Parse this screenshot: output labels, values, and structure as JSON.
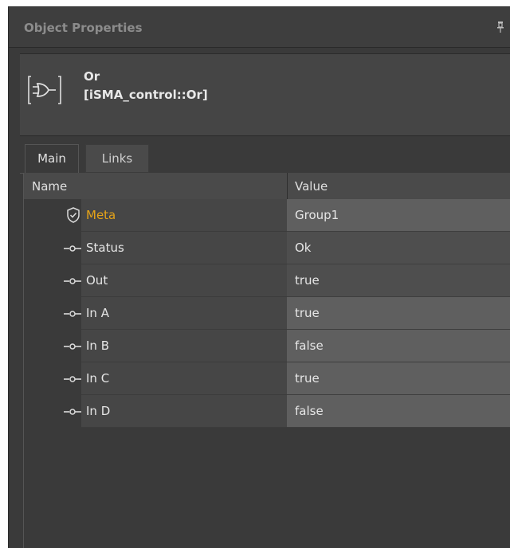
{
  "panel": {
    "title": "Object Properties"
  },
  "object": {
    "name": "Or",
    "type": "[iSMA_control::Or]"
  },
  "tabs": {
    "main": "Main",
    "links": "Links",
    "active": "Main"
  },
  "grid": {
    "col_name": "Name",
    "col_value": "Value",
    "rows": [
      {
        "icon": "shield-check-icon",
        "name": "Meta",
        "value": "Group1"
      },
      {
        "icon": "slot-icon",
        "name": "Status",
        "value": "Ok"
      },
      {
        "icon": "slot-icon",
        "name": "Out",
        "value": "true"
      },
      {
        "icon": "slot-icon",
        "name": "In A",
        "value": "true"
      },
      {
        "icon": "slot-icon",
        "name": "In B",
        "value": "false"
      },
      {
        "icon": "slot-icon",
        "name": "In C",
        "value": "true"
      },
      {
        "icon": "slot-icon",
        "name": "In D",
        "value": "false"
      }
    ]
  },
  "colors": {
    "panel_bg": "#3a3a3a",
    "meta_accent": "#e5a318",
    "text": "#e6e6e6"
  }
}
